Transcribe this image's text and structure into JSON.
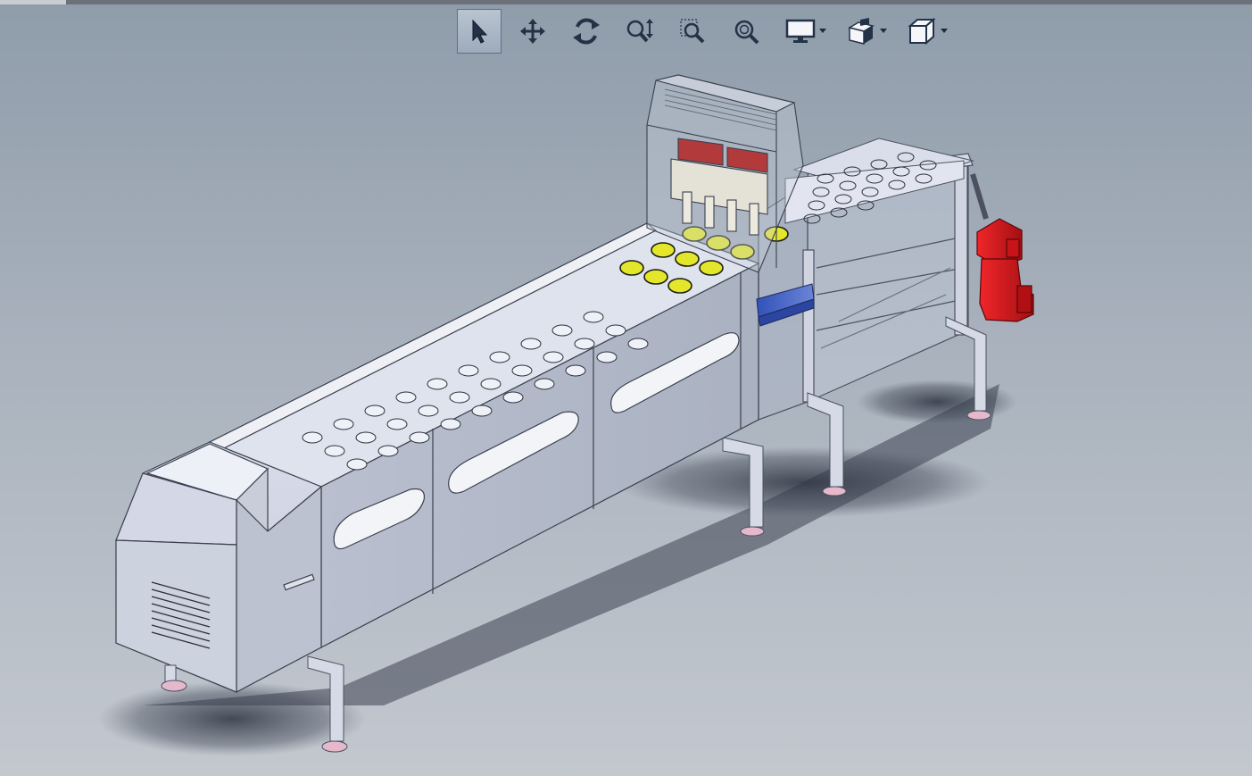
{
  "viewport": {
    "background_top": "#8f9caa",
    "background_bottom": "#c3c8cf"
  },
  "toolbar": {
    "tools": [
      {
        "icon": "select-arrow-icon",
        "active": true
      },
      {
        "icon": "pan-move-icon",
        "active": false
      },
      {
        "icon": "rotate-view-icon",
        "active": false
      },
      {
        "icon": "zoom-in-out-icon",
        "active": false
      },
      {
        "icon": "zoom-to-area-icon",
        "active": false
      },
      {
        "icon": "zoom-to-fit-icon",
        "active": false
      },
      {
        "icon": "display-style-icon",
        "active": false,
        "has_dropdown": true
      },
      {
        "icon": "section-view-icon",
        "active": false,
        "has_dropdown": true
      },
      {
        "icon": "view-orientation-cube-icon",
        "active": false,
        "has_dropdown": true
      }
    ]
  },
  "model": {
    "description_colors": {
      "body": "#c7ccda",
      "body_dark": "#9ea5b6",
      "frame": "#c0c6d4",
      "motor": "#d2141a",
      "cylinder": "#3c58b5",
      "product": "#e3e62a",
      "feet": "#e6b8cc"
    }
  }
}
